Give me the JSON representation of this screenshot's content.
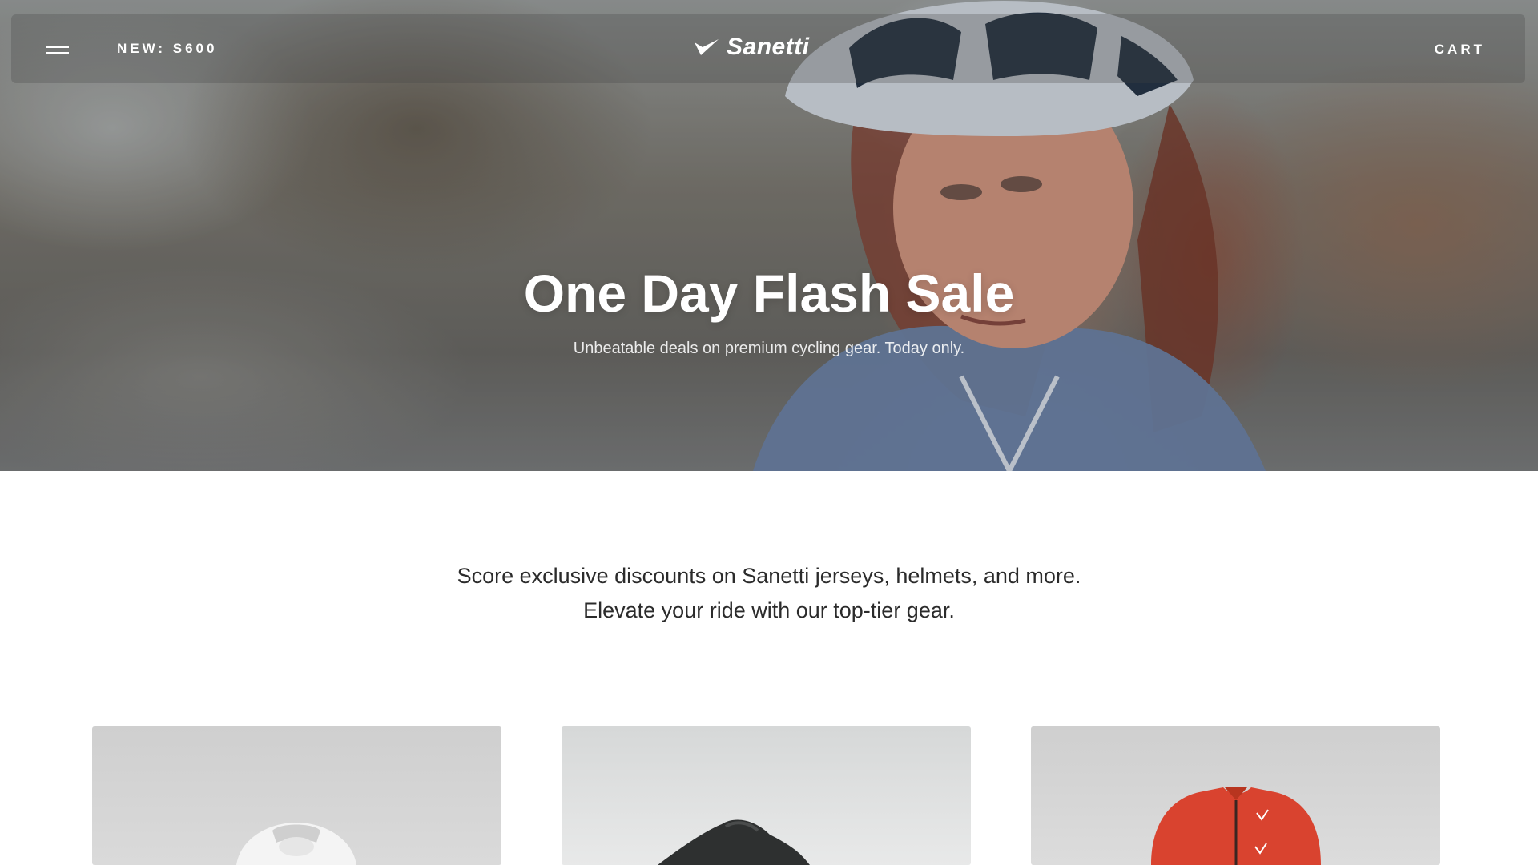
{
  "header": {
    "menu_icon": "hamburger-menu-icon",
    "promo_label": "NEW: S600",
    "brand": "Sanetti",
    "logo_icon": "checkmark-swoosh-icon",
    "cart_label": "CART"
  },
  "hero": {
    "title": "One Day Flash Sale",
    "subtitle": "Unbeatable deals on premium cycling gear. Today only."
  },
  "intro": {
    "line1": "Score exclusive discounts on Sanetti jerseys, helmets, and more.",
    "line2": "Elevate your ride with our top-tier gear."
  },
  "products": [
    {
      "image": "white-helmet-image"
    },
    {
      "image": "black-cycling-shoe-image"
    },
    {
      "image": "red-cycling-jersey-image"
    }
  ],
  "colors": {
    "text_primary": "#2b2b2b",
    "hero_text": "#ffffff",
    "jersey_red": "#d9432f"
  }
}
